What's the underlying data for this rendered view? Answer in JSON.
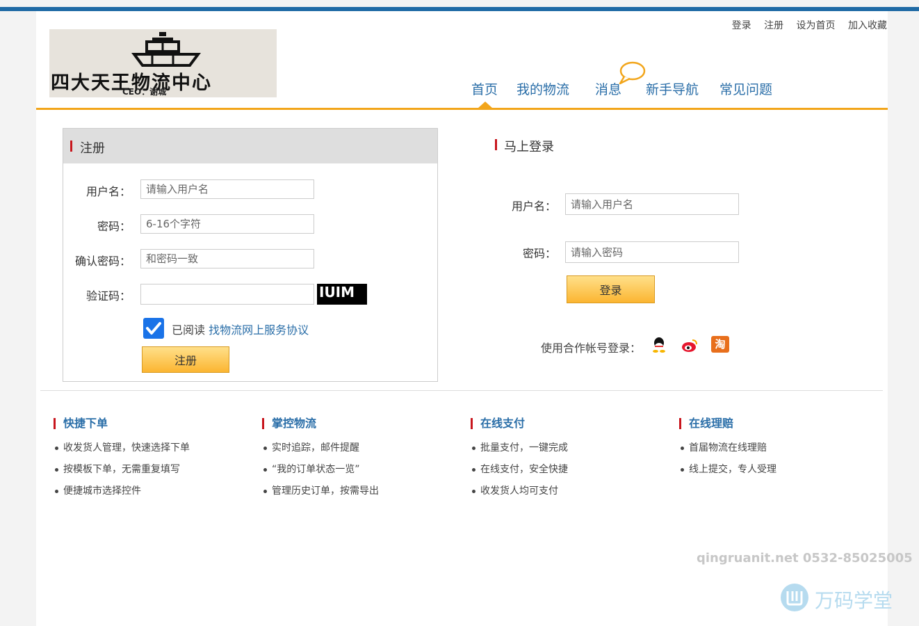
{
  "colors": {
    "accent_blue": "#1f6aa5",
    "link_blue": "#2a6ea8",
    "orange": "#f2a51a",
    "red_marker": "#c8161d"
  },
  "top_links": [
    "登录",
    "注册",
    "设为首页",
    "加入收藏"
  ],
  "logo": {
    "title": "四大天王物流中心",
    "ceo": "CEO：谢城",
    "icon": "ship-icon"
  },
  "nav": [
    "首页",
    "我的物流",
    "消息",
    "新手导航",
    "常见问题"
  ],
  "register": {
    "title": "注册",
    "username_label": "用户名：",
    "username_placeholder": "请输入用户名",
    "password_label": "密码：",
    "password_placeholder": "6-16个字符",
    "confirm_label": "确认密码：",
    "confirm_placeholder": "和密码一致",
    "captcha_label": "验证码：",
    "captcha_text": "IUIM",
    "agree_prefix": "已阅读",
    "agree_link": "找物流网上服务协议",
    "submit": "注册"
  },
  "login": {
    "title": "马上登录",
    "username_label": "用户名：",
    "username_placeholder": "请输入用户名",
    "password_label": "密码：",
    "password_placeholder": "请输入密码",
    "submit": "登录",
    "coop_label": "使用合作帐号登录：",
    "coop_icons": [
      "qq-icon",
      "weibo-icon",
      "taobao-icon"
    ],
    "taobao_glyph": "淘"
  },
  "features": [
    {
      "title": "快捷下单",
      "items": [
        "收发货人管理，快速选择下单",
        "按模板下单，无需重复填写",
        "便捷城市选择控件"
      ]
    },
    {
      "title": "掌控物流",
      "items": [
        "实时追踪，邮件提醒",
        "“我的订单状态一览”",
        "管理历史订单，按需导出"
      ]
    },
    {
      "title": "在线支付",
      "items": [
        "批量支付，一键完成",
        "在线支付，安全快捷",
        "收发货人均可支付"
      ]
    },
    {
      "title": "在线理赔",
      "items": [
        "首届物流在线理赔",
        "线上提交，专人受理"
      ]
    }
  ],
  "watermark": {
    "line1": "qingruanit.net 0532-85025005",
    "brand": "万码学堂"
  }
}
